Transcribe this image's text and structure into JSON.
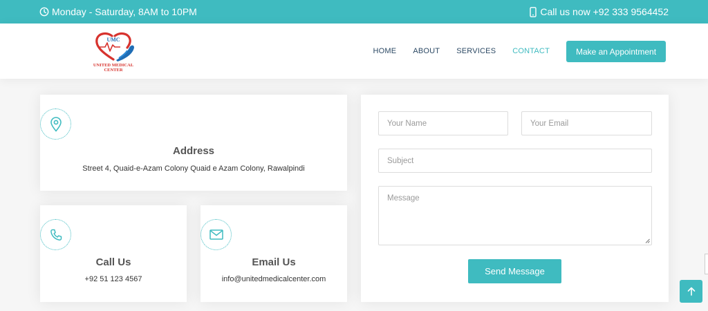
{
  "topbar": {
    "hours": "Monday - Saturday, 8AM to 10PM",
    "call": "Call us now +92 333 9564452",
    "hours_icon": "clock-icon",
    "call_icon": "phone-mobile-icon"
  },
  "header": {
    "logo_initials": "UMC",
    "logo_text_line1": "UNITED MEDICAL",
    "logo_text_line2": "CENTER",
    "nav": [
      "HOME",
      "ABOUT",
      "SERVICES",
      "CONTACT"
    ],
    "active_nav": "CONTACT",
    "appointment_button": "Make an Appointment"
  },
  "info": {
    "address": {
      "title": "Address",
      "text": "Street 4, Quaid-e-Azam Colony Quaid e Azam Colony, Rawalpindi",
      "icon": "map-pin-icon"
    },
    "call": {
      "title": "Call Us",
      "text": "+92 51 123 4567",
      "icon": "phone-icon"
    },
    "email": {
      "title": "Email Us",
      "text": "info@unitedmedicalcenter.com",
      "icon": "envelope-icon"
    }
  },
  "form": {
    "name_placeholder": "Your Name",
    "email_placeholder": "Your Email",
    "subject_placeholder": "Subject",
    "message_placeholder": "Message",
    "send_button": "Send Message"
  },
  "colors": {
    "accent": "#3fbbc0",
    "nav_text": "#2c4964",
    "logo_red": "#d7332e",
    "logo_blue": "#1f6db5"
  }
}
